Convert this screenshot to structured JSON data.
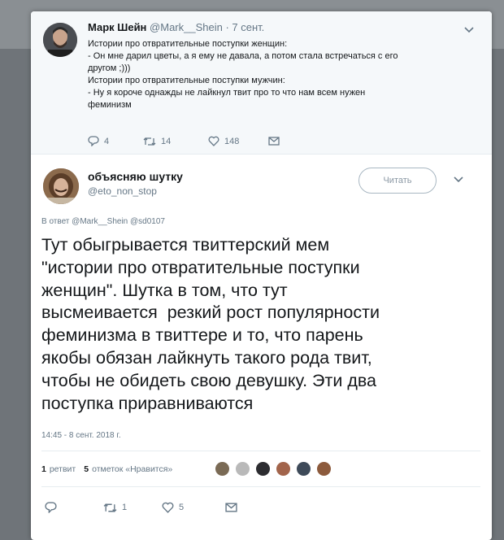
{
  "parent_tweet": {
    "author_name": "Марк Шейн",
    "author_handle": "@Mark__Shein",
    "time": "· 7 сент.",
    "lines": [
      "Истории про отвратительные поступки женщин:",
      "- Он мне дарил цветы, а я ему не давала, а потом стала встречаться с его",
      "другом ;)))",
      "Истории про отвратительные поступки мужчин:",
      "- Ну я короче однажды не лайкнул твит про то что нам всем нужен",
      "феминизм"
    ],
    "replies_count": "4",
    "retweets_count": "14",
    "likes_count": "148"
  },
  "tweet": {
    "author_name": "объясняю шутку",
    "author_handle": "@eto_non_stop",
    "follow_label": "Читать",
    "reply_prefix": "В ответ",
    "reply_mentions": "@Mark__Shein @sd0107",
    "text_lines": [
      "Тут обыгрывается твиттерский мем",
      "\"истории про отвратительные поступки",
      "женщин\". Шутка в том, что тут",
      "высмеивается  резкий рост популярности",
      "феминизма в твиттере и то, что парень",
      "якобы обязан лайкнуть такого рода твит,",
      "чтобы не обидеть свою девушку. Эти два",
      "поступка приравниваются"
    ],
    "timestamp": "14:45 - 8 сент. 2018 г.",
    "retweet_count": "1",
    "retweet_label": "ретвит",
    "likes_count": "5",
    "likes_label": "отметок «Нравится»",
    "action_retweets": "1",
    "action_likes": "5"
  },
  "colors": {
    "background": "#6f7479",
    "card": "#ffffff",
    "parent_bg": "#f5f8fa",
    "muted_text": "#657786"
  }
}
